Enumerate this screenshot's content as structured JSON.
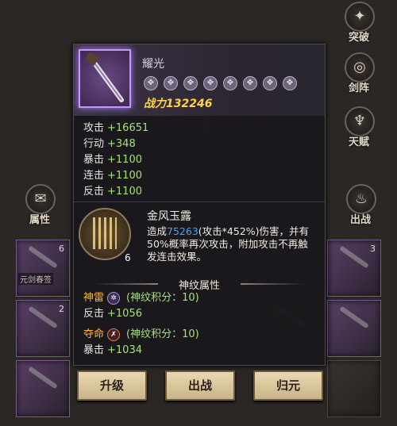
{
  "side_menu": {
    "breakthrough": "突破",
    "formation": "剑阵",
    "talent": "天赋",
    "attribute": "属性",
    "deploy": "出战"
  },
  "inventory": {
    "slot_counts": [
      "6",
      "2",
      "3"
    ],
    "slot_name": "元剑春签"
  },
  "item": {
    "name": "耀光",
    "power": "战力132246",
    "star_icon": "rune-star-icon",
    "stats": [
      {
        "label": "攻击",
        "value": "+16651"
      },
      {
        "label": "行动",
        "value": "+348"
      },
      {
        "label": "暴击",
        "value": "+1100"
      },
      {
        "label": "连击",
        "value": "+1100"
      },
      {
        "label": "反击",
        "value": "+1100"
      }
    ]
  },
  "skill": {
    "name": "金风玉露",
    "level": "6",
    "desc_prefix": "造成",
    "desc_highlight": "75263",
    "desc_rest": "(攻击*452%)伤害，并有50%概率再次攻击，附加攻击不再触发连击效果。"
  },
  "runes": {
    "title": "神纹属性",
    "entries": [
      {
        "name": "神雷",
        "points": "(神纹积分：10)",
        "stat_label": "反击",
        "stat_value": "+1056"
      },
      {
        "name": "夺命",
        "points": "(神纹积分：10)",
        "stat_label": "暴击",
        "stat_value": "+1034"
      }
    ]
  },
  "buttons": {
    "upgrade": "升级",
    "deploy": "出战",
    "return": "归元"
  },
  "colors": {
    "power": "#ffd34a",
    "stat_value": "#a3e07a",
    "rune_name": "#ffb43a",
    "skill_highlight": "#3fa7ff",
    "item_frame": "#c497ff"
  }
}
